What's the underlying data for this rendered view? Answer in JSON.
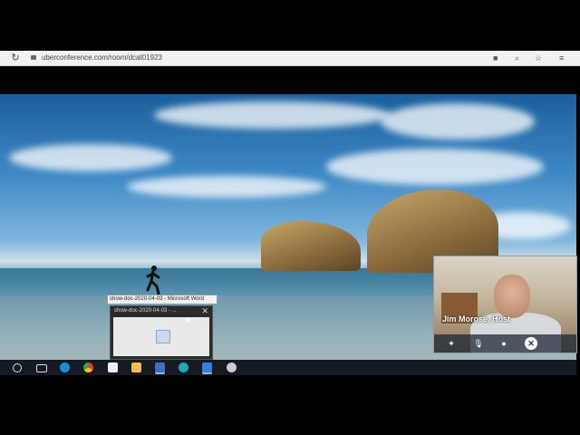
{
  "browser": {
    "url": "uberconference.com/room/dcat01923",
    "icons": [
      "reload-icon",
      "camera-icon",
      "zoom-icon",
      "star-icon",
      "extensions-icon"
    ]
  },
  "taskbar_preview": {
    "tooltip": "show-doc-2020-04-03 - Microsoft Word",
    "title": "show-doc-2020-04-03 - ...",
    "close_label": "✕"
  },
  "video": {
    "host_label": "Jim Morose, Host",
    "controls": [
      "pin-icon",
      "microphone-icon",
      "user-icon",
      "end-call-icon"
    ]
  },
  "taskbar": {
    "items": [
      "cortana-icon",
      "task-view-icon",
      "edge-icon",
      "chrome-icon",
      "store-icon",
      "file-explorer-icon",
      "word-icon",
      "edge-dev-icon",
      "photos-icon",
      "app-icon"
    ]
  },
  "colors": {
    "taskbar": "#141b24",
    "browser_bar": "#f1f1f1",
    "accent": "#8fb8e8"
  }
}
